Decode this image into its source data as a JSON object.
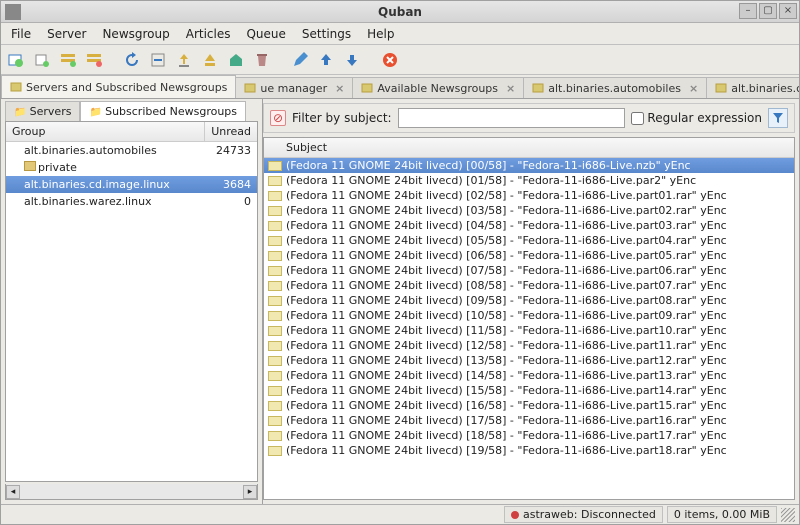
{
  "window": {
    "title": "Quban"
  },
  "menu": [
    "File",
    "Server",
    "Newsgroup",
    "Articles",
    "Queue",
    "Settings",
    "Help"
  ],
  "maintabs": [
    {
      "label": "Servers and Subscribed Newsgroups",
      "icon": "group",
      "close": false
    },
    {
      "label": "ue manager",
      "icon": "queue",
      "close": true
    },
    {
      "label": "Available Newsgroups",
      "icon": "list",
      "close": true
    },
    {
      "label": "alt.binaries.automobiles",
      "icon": "group",
      "close": true
    },
    {
      "label": "alt.binaries.cd.image.linux",
      "icon": "group",
      "close": true
    }
  ],
  "subtabs": [
    {
      "label": "Servers"
    },
    {
      "label": "Subscribed Newsgroups"
    }
  ],
  "tree": {
    "headers": {
      "group": "Group",
      "unread": "Unread"
    },
    "rows": [
      {
        "label": "alt.binaries.automobiles",
        "unread": "24733",
        "sel": false,
        "folder": false
      },
      {
        "label": "private",
        "unread": "",
        "sel": false,
        "folder": true
      },
      {
        "label": "alt.binaries.cd.image.linux",
        "unread": "3684",
        "sel": true,
        "folder": false
      },
      {
        "label": "alt.binaries.warez.linux",
        "unread": "0",
        "sel": false,
        "folder": false
      }
    ]
  },
  "filter": {
    "label": "Filter by subject:",
    "placeholder": "",
    "regex_label": "Regular expression"
  },
  "list": {
    "header": "Subject",
    "base_prefix": "(Fedora 11 GNOME 24bit livecd)",
    "total": "58",
    "rows": [
      {
        "i": "00",
        "file": "\"Fedora-11-i686-Live.nzb\" yEnc",
        "sel": true
      },
      {
        "i": "01",
        "file": "\"Fedora-11-i686-Live.par2\" yEnc",
        "sel": false
      },
      {
        "i": "02",
        "file": "\"Fedora-11-i686-Live.part01.rar\" yEnc",
        "sel": false
      },
      {
        "i": "03",
        "file": "\"Fedora-11-i686-Live.part02.rar\" yEnc",
        "sel": false
      },
      {
        "i": "04",
        "file": "\"Fedora-11-i686-Live.part03.rar\" yEnc",
        "sel": false
      },
      {
        "i": "05",
        "file": "\"Fedora-11-i686-Live.part04.rar\" yEnc",
        "sel": false
      },
      {
        "i": "06",
        "file": "\"Fedora-11-i686-Live.part05.rar\" yEnc",
        "sel": false
      },
      {
        "i": "07",
        "file": "\"Fedora-11-i686-Live.part06.rar\" yEnc",
        "sel": false
      },
      {
        "i": "08",
        "file": "\"Fedora-11-i686-Live.part07.rar\" yEnc",
        "sel": false
      },
      {
        "i": "09",
        "file": "\"Fedora-11-i686-Live.part08.rar\" yEnc",
        "sel": false
      },
      {
        "i": "10",
        "file": "\"Fedora-11-i686-Live.part09.rar\" yEnc",
        "sel": false
      },
      {
        "i": "11",
        "file": "\"Fedora-11-i686-Live.part10.rar\" yEnc",
        "sel": false
      },
      {
        "i": "12",
        "file": "\"Fedora-11-i686-Live.part11.rar\" yEnc",
        "sel": false
      },
      {
        "i": "13",
        "file": "\"Fedora-11-i686-Live.part12.rar\" yEnc",
        "sel": false
      },
      {
        "i": "14",
        "file": "\"Fedora-11-i686-Live.part13.rar\" yEnc",
        "sel": false
      },
      {
        "i": "15",
        "file": "\"Fedora-11-i686-Live.part14.rar\" yEnc",
        "sel": false
      },
      {
        "i": "16",
        "file": "\"Fedora-11-i686-Live.part15.rar\" yEnc",
        "sel": false
      },
      {
        "i": "17",
        "file": "\"Fedora-11-i686-Live.part16.rar\" yEnc",
        "sel": false
      },
      {
        "i": "18",
        "file": "\"Fedora-11-i686-Live.part17.rar\" yEnc",
        "sel": false
      },
      {
        "i": "19",
        "file": "\"Fedora-11-i686-Live.part18.rar\" yEnc",
        "sel": false
      }
    ]
  },
  "status": {
    "server": "astraweb: Disconnected",
    "items": "0 items, 0.00 MiB"
  }
}
